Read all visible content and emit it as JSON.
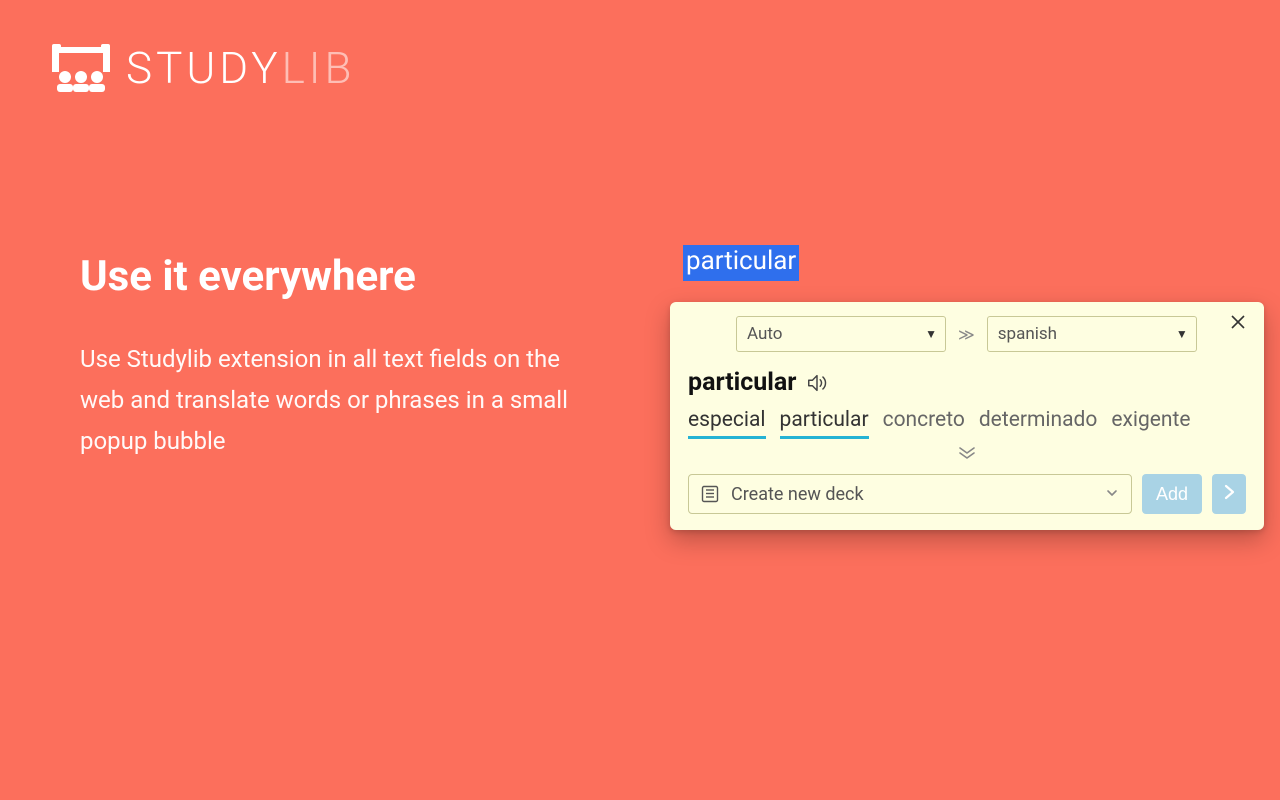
{
  "logo": {
    "brand_a": "STUDY",
    "brand_b": "LIB"
  },
  "hero": {
    "heading": "Use it everywhere",
    "body": "Use Studylib extension in all text fields on the web and translate words or phrases in a small popup bubble"
  },
  "selected_word": "particular",
  "popup": {
    "source_lang": "Auto",
    "target_lang": "spanish",
    "headword": "particular",
    "translations": [
      {
        "text": "especial",
        "active": true
      },
      {
        "text": "particular",
        "active": true
      },
      {
        "text": "concreto",
        "active": false
      },
      {
        "text": "determinado",
        "active": false
      },
      {
        "text": "exigente",
        "active": false
      }
    ],
    "deck_placeholder": "Create new deck",
    "add_label": "Add"
  }
}
